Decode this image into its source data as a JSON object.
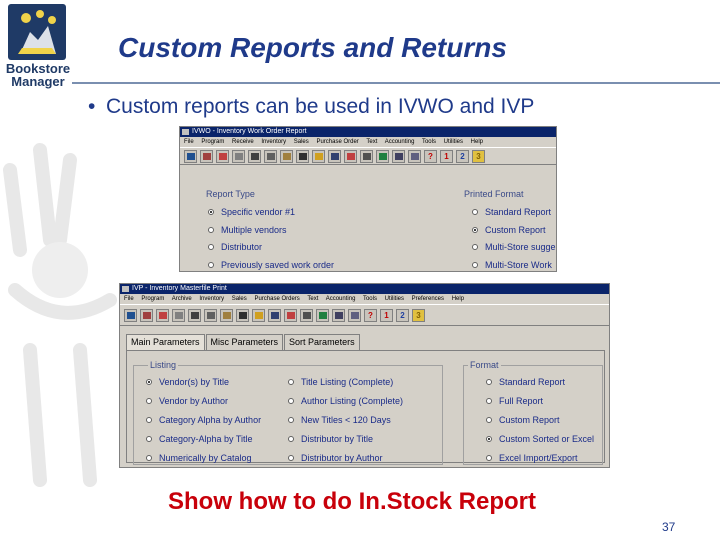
{
  "logo": {
    "line1": "Bookstore",
    "line2": "Manager"
  },
  "title": "Custom Reports and Returns",
  "bullet": "Custom reports can be used in IVWO and IVP",
  "ivwo": {
    "title": "IVWO - Inventory Work Order Report",
    "menu": [
      "File",
      "Program",
      "Receive",
      "Inventory",
      "Sales",
      "Purchase Order",
      "Text",
      "Accounting",
      "Tools",
      "Utilities",
      "Help"
    ],
    "toolbar_numbers": [
      "1",
      "2",
      "3"
    ],
    "report_type_label": "Report Type",
    "report_type_options": [
      "Specific vendor #1",
      "Multiple vendors",
      "Distributor",
      "Previously saved work order"
    ],
    "report_type_selected": 0,
    "printed_format_label": "Printed Format",
    "printed_format_options": [
      "Standard Report",
      "Custom Report",
      "Multi-Store sugge",
      "Multi-Store Work"
    ],
    "printed_format_selected": 1
  },
  "ivp": {
    "title": "IVP - Inventory Masterfile Print",
    "menu": [
      "File",
      "Program",
      "Archive",
      "Inventory",
      "Sales",
      "Purchase Orders",
      "Text",
      "Accounting",
      "Tools",
      "Utilities",
      "Preferences",
      "Help"
    ],
    "toolbar_numbers": [
      "1",
      "2",
      "3"
    ],
    "tabs": [
      "Main Parameters",
      "Misc Parameters",
      "Sort Parameters"
    ],
    "listing_label": "Listing",
    "listing_col1": [
      "Vendor(s) by Title",
      "Vendor by Author",
      "Category Alpha by Author",
      "Category-Alpha by Title",
      "Numerically by Catalog"
    ],
    "listing_col2": [
      "Title Listing (Complete)",
      "Author Listing (Complete)",
      "New Titles < 120 Days",
      "Distributor by Title",
      "Distributor by Author"
    ],
    "listing_selected": 0,
    "format_label": "Format",
    "format_options": [
      "Standard Report",
      "Full Report",
      "Custom Report",
      "Custom Sorted or Excel",
      "Excel Import/Export"
    ],
    "format_selected": 3
  },
  "show_text": "Show how to do In.Stock Report",
  "page_number": "37"
}
